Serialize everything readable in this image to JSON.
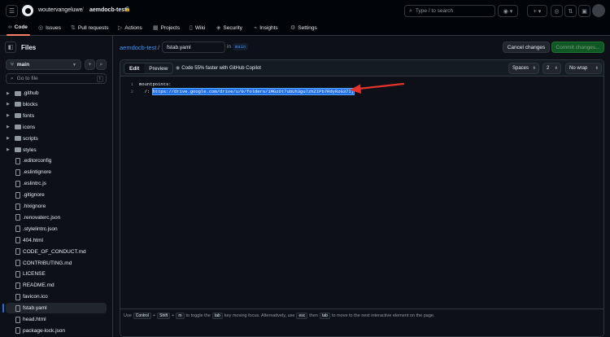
{
  "header": {
    "owner": "woutervangeluwe",
    "separator": "/",
    "repo": "aemdocb-test",
    "search_placeholder": "Type / to search",
    "search_slash_key": "/"
  },
  "nav": {
    "tabs": [
      {
        "label": "Code",
        "icon": "code-icon"
      },
      {
        "label": "Issues",
        "icon": "issue-icon"
      },
      {
        "label": "Pull requests",
        "icon": "pull-request-icon"
      },
      {
        "label": "Actions",
        "icon": "play-icon"
      },
      {
        "label": "Projects",
        "icon": "table-icon"
      },
      {
        "label": "Wiki",
        "icon": "book-icon"
      },
      {
        "label": "Security",
        "icon": "shield-icon"
      },
      {
        "label": "Insights",
        "icon": "graph-icon"
      },
      {
        "label": "Settings",
        "icon": "gear-icon"
      }
    ]
  },
  "sidebar": {
    "title": "Files",
    "branch": "main",
    "go_to_file_placeholder": "Go to file",
    "go_to_file_key": "t",
    "tree": [
      {
        "name": ".github",
        "type": "folder"
      },
      {
        "name": "blocks",
        "type": "folder"
      },
      {
        "name": "fonts",
        "type": "folder"
      },
      {
        "name": "icons",
        "type": "folder"
      },
      {
        "name": "scripts",
        "type": "folder"
      },
      {
        "name": "styles",
        "type": "folder"
      },
      {
        "name": ".editorconfig",
        "type": "file"
      },
      {
        "name": ".eslintignore",
        "type": "file"
      },
      {
        "name": ".eslintrc.js",
        "type": "file"
      },
      {
        "name": ".gitignore",
        "type": "file"
      },
      {
        "name": ".hlxignore",
        "type": "file"
      },
      {
        "name": ".renovaterc.json",
        "type": "file"
      },
      {
        "name": ".stylelintrc.json",
        "type": "file"
      },
      {
        "name": "404.html",
        "type": "file"
      },
      {
        "name": "CODE_OF_CONDUCT.md",
        "type": "file"
      },
      {
        "name": "CONTRIBUTING.md",
        "type": "file"
      },
      {
        "name": "LICENSE",
        "type": "file"
      },
      {
        "name": "README.md",
        "type": "file"
      },
      {
        "name": "favicon.ico",
        "type": "file"
      },
      {
        "name": "fstab.yaml",
        "type": "file",
        "selected": true
      },
      {
        "name": "head.html",
        "type": "file"
      },
      {
        "name": "package-lock.json",
        "type": "file"
      }
    ]
  },
  "editor": {
    "breadcrumb_repo": "aemdocb-test",
    "breadcrumb_sep": "/",
    "filename": "fstab.yaml",
    "in_label": "in",
    "branch": "main",
    "cancel_label": "Cancel changes",
    "commit_label": "Commit changes...",
    "tab_edit": "Edit",
    "tab_preview": "Preview",
    "copilot_text": "Code 55% faster with GitHub Copilot",
    "indent_mode": "Spaces",
    "indent_size": "2",
    "wrap_mode": "No wrap",
    "lines": [
      {
        "num": "1",
        "text": "mountpoints:"
      },
      {
        "num": "2",
        "prefix": "  /: ",
        "url": "https://drive.google.com/drive/u/0/folders/1MGzOt7ubUh3gu7zhZIPb7RdyRzG37Ij"
      }
    ]
  },
  "footer": {
    "use": "Use",
    "k_control": "Control",
    "plus1": "+",
    "k_shift": "Shift",
    "plus2": "+",
    "k_m": "m",
    "t1": "to toggle the",
    "k_tab": "tab",
    "t2": "key moving focus. Alternatively, use",
    "k_esc": "esc",
    "t3": "then",
    "k_tab2": "tab",
    "t4": "to move to the next interactive element on the page."
  },
  "colors": {
    "accent_link": "#4493f8",
    "selection": "#1f6feb",
    "annotation_arrow": "#e5322d",
    "commit_button": "#105823"
  }
}
